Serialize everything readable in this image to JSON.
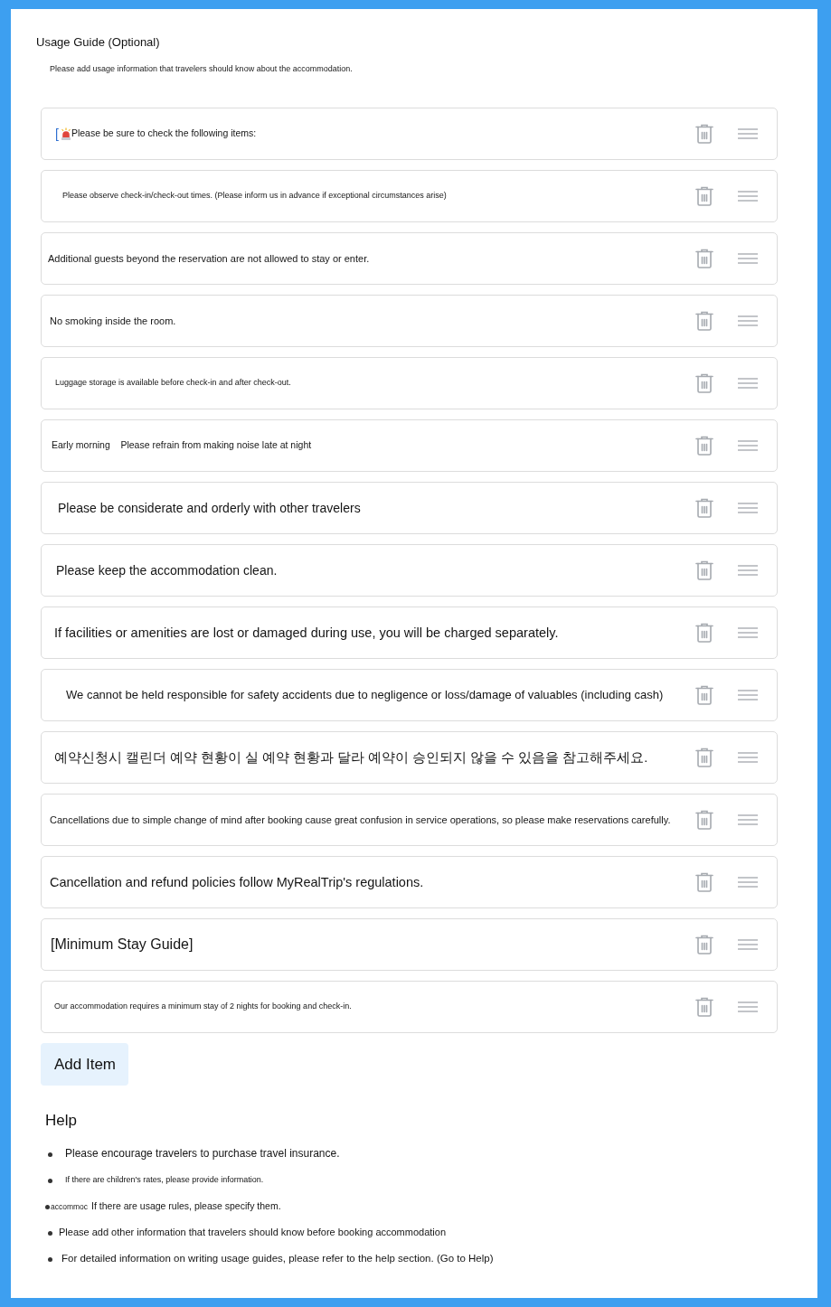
{
  "title": "Usage Guide (Optional)",
  "description": "Please add usage information that travelers should know about the accommodation.",
  "items": [
    {
      "kind": "notice",
      "prefix": "[",
      "text": "Please be sure to check the following items:"
    },
    {
      "kind": "plain",
      "text": "Please observe check-in/check-out times. (Please inform us in advance if exceptional circumstances arise)"
    },
    {
      "kind": "plain",
      "text": "Additional guests beyond the reservation are not allowed to stay or enter."
    },
    {
      "kind": "plain",
      "text": "No smoking inside the room."
    },
    {
      "kind": "plain",
      "text": "Luggage storage is available before check-in and after check-out."
    },
    {
      "kind": "plain",
      "text": "Early morning    Please refrain from making noise late at night"
    },
    {
      "kind": "plain",
      "text": "Please be considerate and orderly with other travelers"
    },
    {
      "kind": "plain",
      "text": "Please keep the accommodation clean."
    },
    {
      "kind": "plain",
      "text": "If facilities or amenities are lost or damaged during use, you will be charged separately."
    },
    {
      "kind": "plain",
      "text": "We cannot be held responsible for safety accidents due to negligence or loss/damage of valuables (including cash)"
    },
    {
      "kind": "plain",
      "text": "예약신청시 캘린더 예약 현황이 실 예약 현황과 달라 예약이 승인되지 않을 수 있음을 참고해주세요."
    },
    {
      "kind": "plain",
      "text": "Cancellations due to simple change of mind after booking cause great confusion in service operations, so please make reservations carefully."
    },
    {
      "kind": "plain",
      "text": "Cancellation and refund policies follow MyRealTrip's regulations."
    },
    {
      "kind": "plain",
      "text": "[Minimum Stay Guide]"
    },
    {
      "kind": "plain",
      "text": "Our accommodation requires a minimum stay of 2 nights for booking and check-in."
    }
  ],
  "add_button": "Add Item",
  "help": {
    "heading": "Help",
    "items": [
      {
        "kind": "bullet",
        "text": "Please encourage travelers to purchase travel insurance."
      },
      {
        "kind": "bullet",
        "text": "If there are children's rates, please provide information."
      },
      {
        "kind": "clipped_label",
        "label": "accommoc",
        "text": "If there are usage rules, please specify them."
      },
      {
        "kind": "bullet",
        "text": "Please add other information that travelers should know before booking accommodation"
      },
      {
        "kind": "bullet",
        "text": "For detailed information on writing usage guides, please refer to the help section. (Go to Help)"
      }
    ]
  }
}
